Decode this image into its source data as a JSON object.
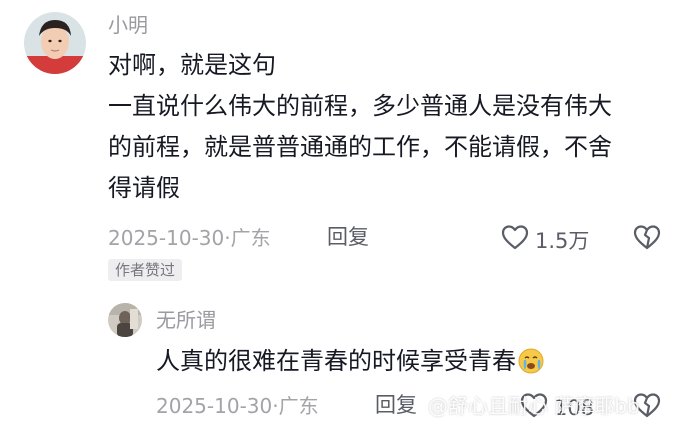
{
  "comments": [
    {
      "username": "小明",
      "lines": [
        "对啊，就是这句",
        "一直说什么伟大的前程，多少普通人是没有伟大",
        "的前程，就是普普通通的工作，不能请假，不舍",
        "得请假"
      ],
      "meta": "2025-10-30·广东",
      "reply_label": "回复",
      "like_count": "1.5万",
      "badge": "作者赞过"
    },
    {
      "username": "无所谓",
      "text": "人真的很难在青春的时候享受青春",
      "emoji": "crying-face",
      "meta": "2025-10-30·广东",
      "reply_label": "回复",
      "like_count": "108"
    }
  ],
  "watermark": "@舒心且耐心 萨摩耶bb",
  "icons": {
    "like": "heart-outline-icon",
    "dislike": "broken-heart-outline-icon"
  }
}
